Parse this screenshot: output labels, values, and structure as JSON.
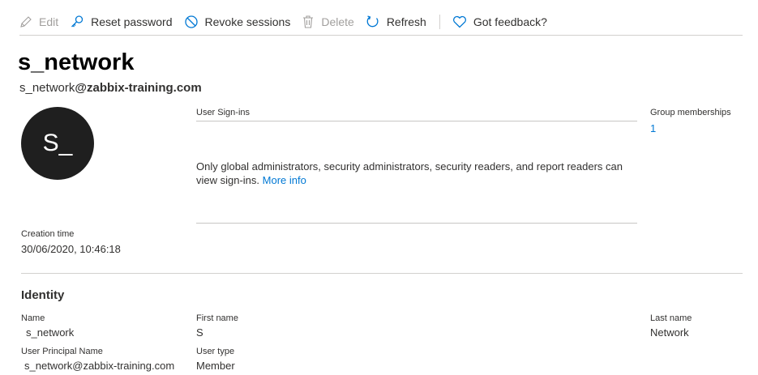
{
  "toolbar": {
    "edit_label": "Edit",
    "reset_password_label": "Reset password",
    "revoke_sessions_label": "Revoke sessions",
    "delete_label": "Delete",
    "refresh_label": "Refresh",
    "feedback_label": "Got feedback?"
  },
  "user": {
    "display_name": "s_network",
    "email_prefix": "s_network",
    "email_domain": "@zabbix-training.com",
    "avatar_initials": "S_"
  },
  "signins": {
    "title": "User Sign-ins",
    "message": "Only global administrators, security administrators, security readers, and report readers can view sign-ins.",
    "more_info_label": "More info"
  },
  "groups": {
    "label": "Group memberships",
    "count": "1"
  },
  "creation": {
    "label": "Creation time",
    "value": "30/06/2020, 10:46:18"
  },
  "identity": {
    "title": "Identity",
    "name_label": "Name",
    "name_value": "s_network",
    "first_name_label": "First name",
    "first_name_value": "S",
    "last_name_label": "Last name",
    "last_name_value": "Network",
    "upn_label": "User Principal Name",
    "upn_value": "s_network@zabbix-training.com",
    "user_type_label": "User type",
    "user_type_value": "Member"
  },
  "colors": {
    "accent": "#0078d4",
    "avatar_bg": "#1f1f1f",
    "disabled": "#a19f9d"
  }
}
